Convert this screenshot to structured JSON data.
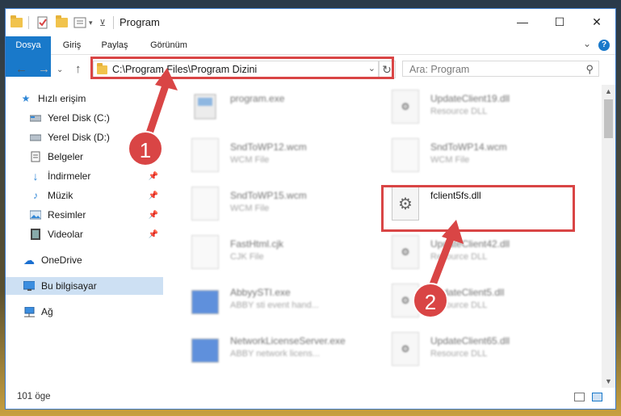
{
  "window": {
    "title": "Program",
    "controls": {
      "minimize": "—",
      "maximize": "☐",
      "close": "✕"
    }
  },
  "ribbon": {
    "tabs": [
      "Dosya",
      "Giriş",
      "Paylaş",
      "Görünüm"
    ]
  },
  "address": {
    "path": "C:\\Program Files\\Program Dizini",
    "search_placeholder": "Ara: Program"
  },
  "sidebar": {
    "items": [
      {
        "label": "Hızlı erişim",
        "icon": "star-icon"
      },
      {
        "label": "Yerel Disk (C:)",
        "icon": "drive-icon"
      },
      {
        "label": "Yerel Disk (D:)",
        "icon": "drive-icon"
      },
      {
        "label": "Belgeler",
        "icon": "document-icon"
      },
      {
        "label": "İndirmeler",
        "icon": "download-icon",
        "pinned": true
      },
      {
        "label": "Müzik",
        "icon": "music-icon",
        "pinned": true
      },
      {
        "label": "Resimler",
        "icon": "pictures-icon",
        "pinned": true
      },
      {
        "label": "Videolar",
        "icon": "video-icon",
        "pinned": true
      },
      {
        "label": "OneDrive",
        "icon": "cloud-icon"
      },
      {
        "label": "Bu bilgisayar",
        "icon": "computer-icon",
        "selected": true
      },
      {
        "label": "Ağ",
        "icon": "network-icon"
      }
    ]
  },
  "files": {
    "left": [
      {
        "name": "program.exe",
        "type": ""
      },
      {
        "name": "SndToWP12.wcm",
        "type": "WCM File"
      },
      {
        "name": "SndToWP15.wcm",
        "type": "WCM File"
      },
      {
        "name": "FastHtml.cjk",
        "type": "CJK File"
      },
      {
        "name": "AbbyySTI.exe",
        "type": "ABBY sti event hand..."
      },
      {
        "name": "NetworkLicenseServer.exe",
        "type": "ABBY network licens..."
      }
    ],
    "right": [
      {
        "name": "UpdateClient19.dll",
        "type": "Resource DLL"
      },
      {
        "name": "SndToWP14.wcm",
        "type": "WCM File"
      },
      {
        "name": "fclient5fs.dll",
        "type": ""
      },
      {
        "name": "UpdateClient42.dll",
        "type": "Resource DLL"
      },
      {
        "name": "UpdateClient5.dll",
        "type": "Resource DLL"
      },
      {
        "name": "UpdateClient65.dll",
        "type": "Resource DLL"
      }
    ]
  },
  "status": {
    "count": "101 öge"
  },
  "annotations": {
    "step1": "1",
    "step2": "2"
  },
  "colors": {
    "accent": "#1979ca",
    "highlight": "#d94545"
  }
}
